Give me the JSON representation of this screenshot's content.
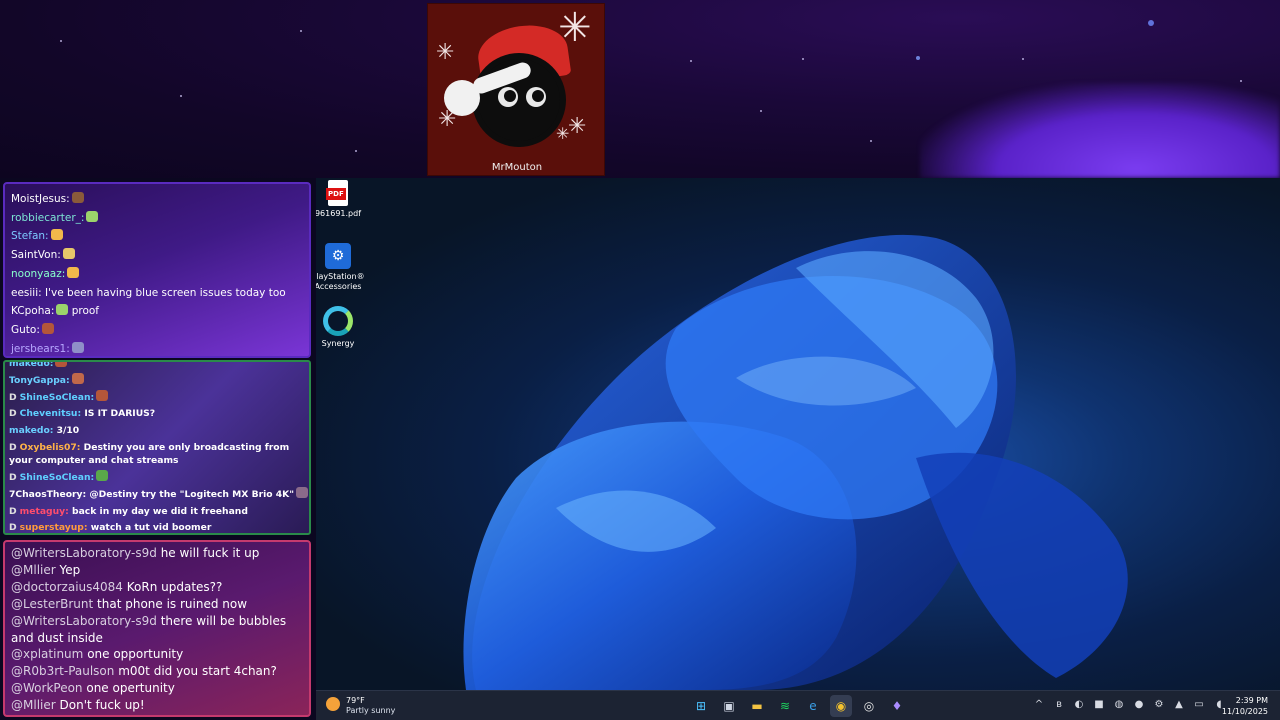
{
  "banner": {
    "streamer_name": "MrMouton"
  },
  "desktop": {
    "icons": [
      {
        "label": "961691.pdf",
        "icon": "pdf-file-icon"
      },
      {
        "label": "PlayStation® Accessories",
        "icon": "playstation-icon"
      },
      {
        "label": "Synergy",
        "icon": "synergy-icon"
      }
    ]
  },
  "chat_top": {
    "messages": [
      {
        "user": "MoistJesus:",
        "text": "",
        "user_color": "#ffffff",
        "emote_color": "#8a5a3a"
      },
      {
        "user": "robbiecarter_:",
        "text": "",
        "user_color": "#7ee6d5",
        "emote_color": "#9bd36b"
      },
      {
        "user": "Stefan:",
        "text": "",
        "user_color": "#7dc9ff",
        "emote_color": "#f2b84b"
      },
      {
        "user": "SaintVon:",
        "text": "",
        "user_color": "#ffffff",
        "emote_color": "#e6c76a"
      },
      {
        "user": "noonyaaz:",
        "text": "",
        "user_color": "#88ffcc",
        "emote_color": "#f2b84b"
      },
      {
        "user": "eesiii:",
        "text": "I've been having blue screen issues today too",
        "user_color": "#ffffff",
        "emote_color": ""
      },
      {
        "user": "KCpoha:",
        "text": "proof",
        "user_color": "#ffffff",
        "emote_color": "#9bd36b"
      },
      {
        "user": "Guto:",
        "text": "",
        "user_color": "#ffffff",
        "emote_color": "#b4563a"
      },
      {
        "user": "jersbears1:",
        "text": "",
        "user_color": "#b8a8ff",
        "emote_color": "#8f8fc8"
      }
    ]
  },
  "chat_mid": {
    "messages": [
      {
        "badge": "",
        "user": "makedo:",
        "text": "",
        "user_color": "#6ad0ff",
        "emote_color": "#b4563a"
      },
      {
        "badge": "",
        "user": "TonyGappa:",
        "text": "",
        "user_color": "#6ad0ff",
        "emote_color": "#c0684a"
      },
      {
        "badge": "D",
        "user": "ShineSoClean:",
        "text": "",
        "user_color": "#5fd0ff",
        "emote_color": "#b4563a"
      },
      {
        "badge": "D",
        "user": "Chevenitsu:",
        "text": "IS IT DARIUS?",
        "user_color": "#5fd0ff",
        "emote_color": ""
      },
      {
        "badge": "",
        "user": "makedo:",
        "text": "3/10",
        "user_color": "#6ad0ff",
        "emote_color": ""
      },
      {
        "badge": "D",
        "user": "Oxybelis07:",
        "text": "Destiny you are only broadcasting from your computer and chat streams",
        "user_color": "#ffb347",
        "emote_color": "",
        "wrap": true
      },
      {
        "badge": "D",
        "user": "ShineSoClean:",
        "text": "",
        "user_color": "#5fd0ff",
        "emote_color": "#5aa84a"
      },
      {
        "badge": "",
        "user": "7ChaosTheory:",
        "text": "@Destiny try the \"Logitech MX Brio 4K\"",
        "user_color": "#ffffff",
        "emote_color": "#8a6a8a"
      },
      {
        "badge": "D",
        "user": "metaguy:",
        "text": "back in my day we did it freehand",
        "user_color": "#ff4d6d",
        "emote_color": ""
      },
      {
        "badge": "D",
        "user": "superstayup:",
        "text": "watch a tut vid boomer",
        "user_color": "#ff9a3c",
        "emote_color": ""
      }
    ]
  },
  "chat_bottom": {
    "messages": [
      {
        "user": "@WritersLaboratory-s9d",
        "text": "he will fuck it up"
      },
      {
        "user": "@Mllier",
        "text": "Yep"
      },
      {
        "user": "@doctorzaius4084",
        "text": "KoRn updates??"
      },
      {
        "user": "@LesterBrunt",
        "text": "that phone is ruined now"
      },
      {
        "user": "@WritersLaboratory-s9d",
        "text": "there will be bubbles and dust inside"
      },
      {
        "user": "@xplatinum",
        "text": "one opportunity"
      },
      {
        "user": "@R0b3rt-Paulson",
        "text": "m00t did you start 4chan?"
      },
      {
        "user": "@WorkPeon",
        "text": "one opertunity"
      },
      {
        "user": "@Mllier",
        "text": "Don't fuck up!"
      }
    ]
  },
  "taskbar": {
    "weather_temp": "79°F",
    "weather_desc": "Partly sunny",
    "apps": [
      {
        "icon": "windows-start-icon",
        "glyph": "⊞",
        "color": "#4cc2ff",
        "active": false
      },
      {
        "icon": "task-view-icon",
        "glyph": "▣",
        "color": "#cfd6e4",
        "active": false
      },
      {
        "icon": "file-explorer-icon",
        "glyph": "▬",
        "color": "#f3c343",
        "active": false
      },
      {
        "icon": "spotify-icon",
        "glyph": "≋",
        "color": "#1ed760",
        "active": false
      },
      {
        "icon": "edge-icon",
        "glyph": "e",
        "color": "#3aa0e8",
        "active": false
      },
      {
        "icon": "chrome-icon",
        "glyph": "◉",
        "color": "#f2c12e",
        "active": true
      },
      {
        "icon": "obs-icon",
        "glyph": "◎",
        "color": "#e6e6e6",
        "active": false
      },
      {
        "icon": "purple-app-icon",
        "glyph": "♦",
        "color": "#a98bff",
        "active": false
      }
    ],
    "tray": [
      {
        "icon": "chevron-up-icon",
        "glyph": "^"
      },
      {
        "icon": "bluetooth-icon",
        "glyph": "ʙ"
      },
      {
        "icon": "green-tray-icon",
        "glyph": "◐"
      },
      {
        "icon": "purple-tray-icon",
        "glyph": "■"
      },
      {
        "icon": "steam-icon",
        "glyph": "◍"
      },
      {
        "icon": "blue-tray-icon",
        "glyph": "●"
      },
      {
        "icon": "settings-tray-icon",
        "glyph": "⚙"
      },
      {
        "icon": "nvidia-icon",
        "glyph": "▲"
      },
      {
        "icon": "network-icon",
        "glyph": "▭"
      },
      {
        "icon": "volume-icon",
        "glyph": "◖"
      }
    ],
    "time": "2:39 PM",
    "date": "11/10/2025"
  }
}
